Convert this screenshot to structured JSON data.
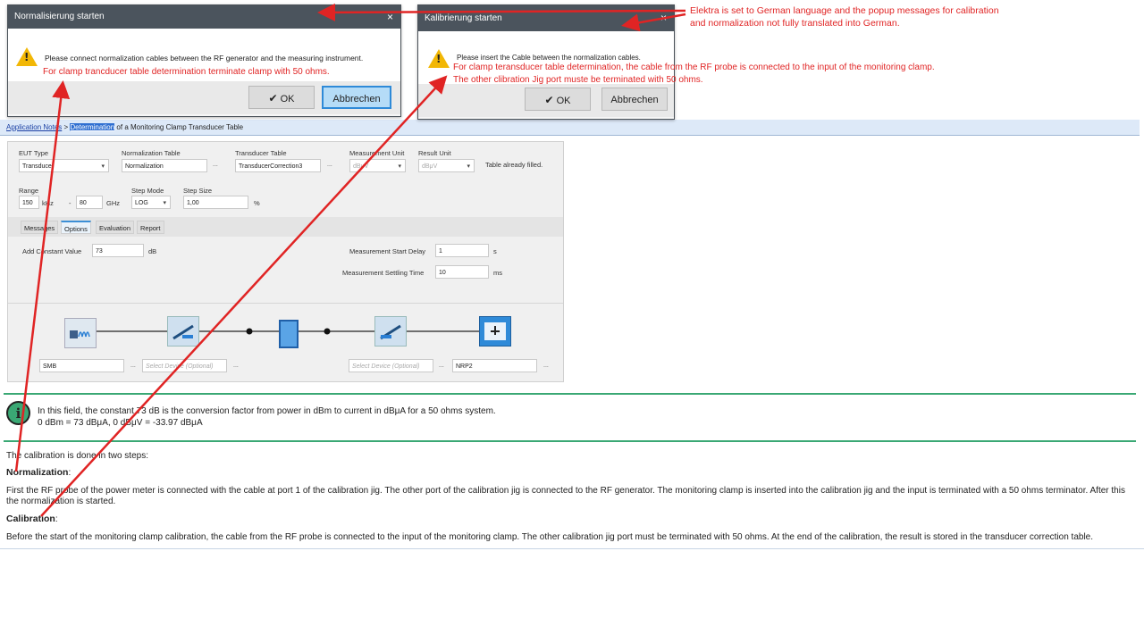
{
  "breadcrumb": {
    "root": "Application Notes",
    "sep": " > ",
    "highlight": "Determination",
    "rest": " of a Monitoring Clamp Transducer Table"
  },
  "form": {
    "eut_type_label": "EUT Type",
    "eut_type_value": "Transducer",
    "norm_table_label": "Normalization Table",
    "norm_table_value": "Normalization",
    "transducer_table_label": "Transducer Table",
    "transducer_table_value": "TransducerCorrection3",
    "meas_unit_label": "Measurement Unit",
    "meas_unit_value": "dBμV",
    "result_unit_label": "Result Unit",
    "result_unit_value": "dBμV",
    "table_filled": "Table already filled.",
    "range_label": "Range",
    "range_start": "150",
    "range_start_unit": "kHz",
    "range_dash": "-",
    "range_stop": "80",
    "range_stop_unit": "GHz",
    "step_mode_label": "Step Mode",
    "step_mode_value": "LOG",
    "step_size_label": "Step Size",
    "step_size_value": "1,00",
    "step_size_unit": "%",
    "dots": "..."
  },
  "tabs": [
    "Messages",
    "Options",
    "Evaluation",
    "Report"
  ],
  "options": {
    "add_const_label": "Add Constant Value",
    "add_const_value": "73",
    "add_const_unit": "dB",
    "start_delay_label": "Measurement Start Delay",
    "start_delay_value": "1",
    "start_delay_unit": "s",
    "settling_label": "Measurement Settling Time",
    "settling_value": "10",
    "settling_unit": "ms"
  },
  "devices": {
    "dev1": "SMB",
    "dev2": "Select Device (Optional)",
    "dev3": "Select Device (Optional)",
    "dev4": "NRP2"
  },
  "info": {
    "line1": "In this field, the constant 73 dB is the conversion factor from power in dBm to current in dBμA for a 50 ohms system.",
    "line2": "0 dBm = 73 dBμA, 0 dBμV = -33.97 dBμA"
  },
  "text": {
    "intro": "The calibration is done in two steps:",
    "norm_heading": "Normalization",
    "norm_colon": ":",
    "norm_body": "First the RF probe of the power meter is connected with the cable at port 1 of the calibration jig. The other port of the calibration jig is connected to the RF generator. The monitoring clamp is inserted into the calibration jig and the input is terminated with a 50 ohms terminator. After this the normalization is started.",
    "cal_heading": "Calibration",
    "cal_colon": ":",
    "cal_body": "Before the start of the monitoring clamp calibration, the cable from the RF probe is connected to the input of the monitoring clamp. The other calibration jig port must be terminated with 50 ohms. At the end of the calibration, the result is stored in the transducer correction table."
  },
  "dialog_norm": {
    "title": "Normalisierung starten",
    "close": "×",
    "message": "Please connect normalization cables between the RF generator and the measuring instrument.",
    "note": "For clamp trancducer table determination terminate clamp with 50 ohms.",
    "ok": "OK",
    "cancel": "Abbrechen"
  },
  "dialog_cal": {
    "title": "Kalibrierung starten",
    "close": "×",
    "message": "Please insert the Cable between the normalization cables.",
    "note1": "For clamp teransducer table determination, the cable from the RF probe is connected to the input of the monitoring clamp.",
    "note2": "The other clibration Jig port muste be terminated with 50 ohms.",
    "ok": "OK",
    "cancel": "Abbrechen"
  },
  "annotation": {
    "line1": "Elektra is set to German language and the popup messages for calibration",
    "line2": "and normalization not fully translated into German."
  },
  "colors": {
    "accent_red": "#e02424",
    "dialog_title": "#4b545d",
    "primary_button": "#2e8ad8",
    "info_border": "#3aa874"
  },
  "icons": [
    "warning-icon",
    "check-icon",
    "info-icon",
    "signal-generator-icon",
    "switch-icon",
    "clamp-device-icon",
    "power-meter-icon"
  ]
}
